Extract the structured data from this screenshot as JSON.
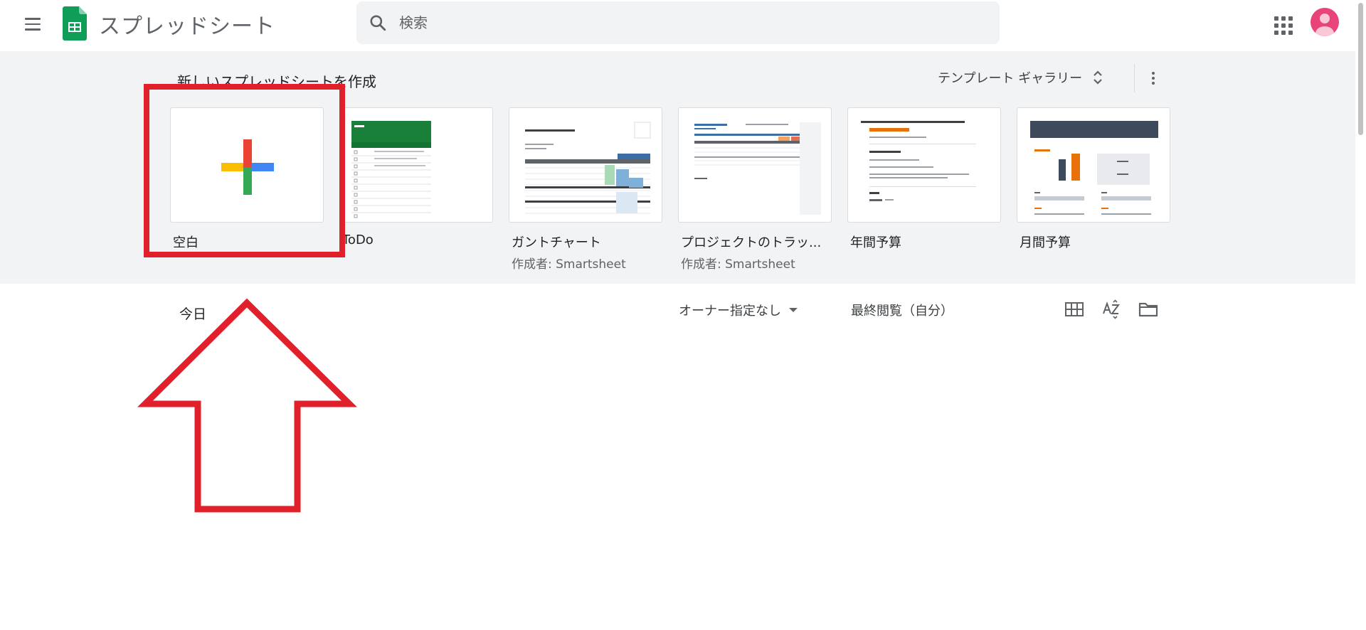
{
  "header": {
    "app_name": "スプレッドシート",
    "search_placeholder": "検索"
  },
  "templates": {
    "section_title": "新しいスプレッドシートを作成",
    "gallery_label": "テンプレート ギャラリー",
    "items": [
      {
        "label": "空白",
        "sub": ""
      },
      {
        "label": "ToDo",
        "sub": ""
      },
      {
        "label": "ガントチャート",
        "sub": "作成者: Smartsheet"
      },
      {
        "label": "プロジェクトのトラッ...",
        "sub": "作成者: Smartsheet"
      },
      {
        "label": "年間予算",
        "sub": ""
      },
      {
        "label": "月間予算",
        "sub": ""
      }
    ]
  },
  "docs": {
    "today_label": "今日",
    "owner_filter": "オーナー指定なし",
    "sort_label": "最終閲覧（自分）"
  },
  "colors": {
    "highlight": "#e0202a",
    "section_bg": "#f1f3f4",
    "sheets_green": "#0f9d58"
  }
}
